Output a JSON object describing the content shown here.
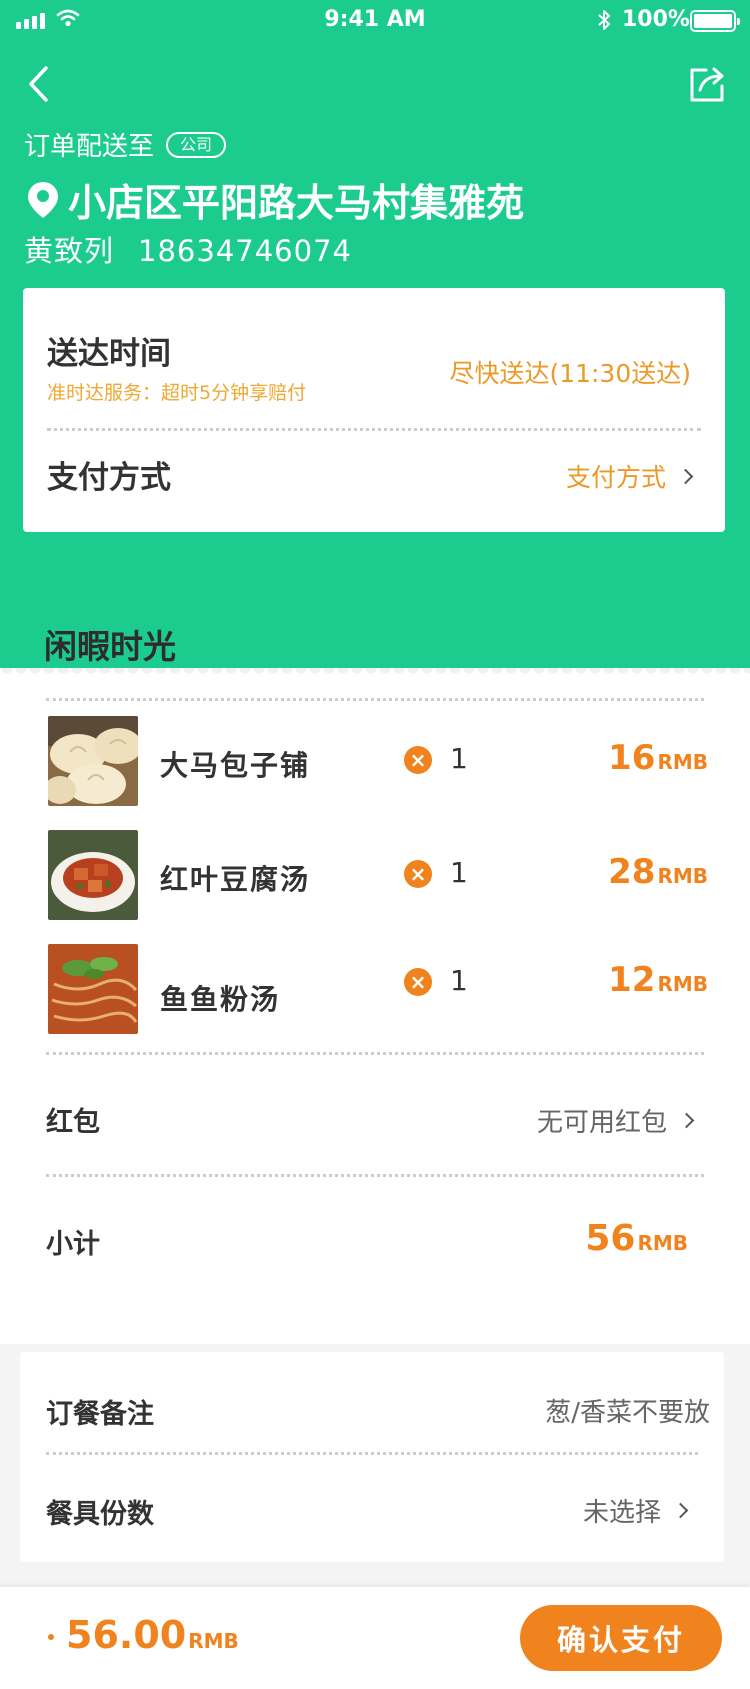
{
  "status_bar": {
    "time": "9:41 AM",
    "battery": "100%"
  },
  "colors": {
    "brand_green": "#1ccc8f",
    "accent_orange": "#f0831e",
    "gold": "#eb9a2a"
  },
  "header": {
    "deliver_to_label": "订单配送至",
    "address_tag": "公司",
    "address": "小店区平阳路大马村集雅苑",
    "contact_name": "黄致列",
    "contact_phone": "18634746074"
  },
  "delivery": {
    "title": "送达时间",
    "subtitle": "准时达服务：超时5分钟享赔付",
    "value": "尽快送达(11:30送达)"
  },
  "payment": {
    "title": "支付方式",
    "value": "支付方式"
  },
  "shop": {
    "name": "闲暇时光"
  },
  "items": [
    {
      "name": "大马包子铺",
      "qty": "1",
      "price": "16",
      "unit": "RMB",
      "image": "steamed-buns"
    },
    {
      "name": "红叶豆腐汤",
      "qty": "1",
      "price": "28",
      "unit": "RMB",
      "image": "braised-tofu"
    },
    {
      "name": "鱼鱼粉汤",
      "qty": "1",
      "price": "12",
      "unit": "RMB",
      "image": "noodle-soup"
    }
  ],
  "red_packet": {
    "label": "红包",
    "value": "无可用红包"
  },
  "subtotal": {
    "label": "小计",
    "value": "56",
    "unit": "RMB"
  },
  "remark": {
    "label": "订餐备注",
    "value": "葱/香菜不要放"
  },
  "tableware": {
    "label": "餐具份数",
    "value": "未选择"
  },
  "footer": {
    "total": "56.00",
    "unit": "RMB",
    "confirm_label": "确认支付"
  }
}
